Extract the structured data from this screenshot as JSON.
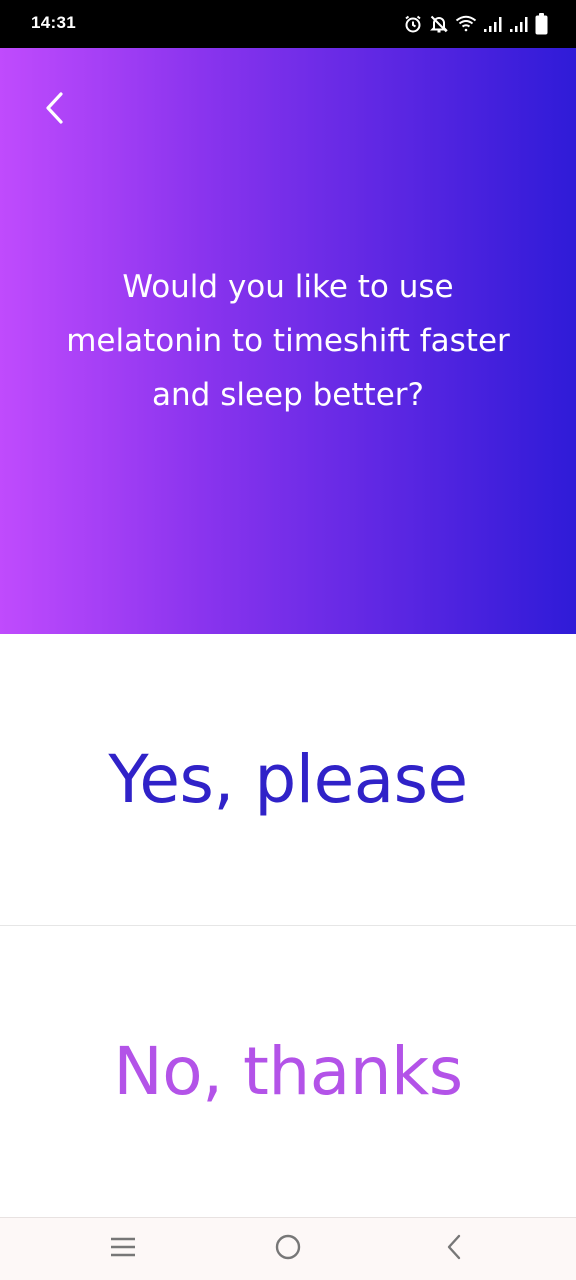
{
  "status_bar": {
    "time": "14:31",
    "icons": [
      "alarm-icon",
      "muted-bell-icon",
      "wifi-icon",
      "signal-icon",
      "signal-icon",
      "battery-icon"
    ]
  },
  "header": {
    "back_icon": "chevron-left-icon",
    "question": "Would you like to use melatonin to timeshift faster and sleep better?"
  },
  "options": {
    "yes_label": "Yes, please",
    "no_label": "No, thanks"
  },
  "nav_bar": {
    "icons": [
      "recents-icon",
      "home-icon",
      "back-icon"
    ]
  },
  "colors": {
    "gradient_start": "#c04bfd",
    "gradient_end": "#2f1bd8",
    "yes_color": "#3022c8",
    "no_color": "#b353e8"
  }
}
